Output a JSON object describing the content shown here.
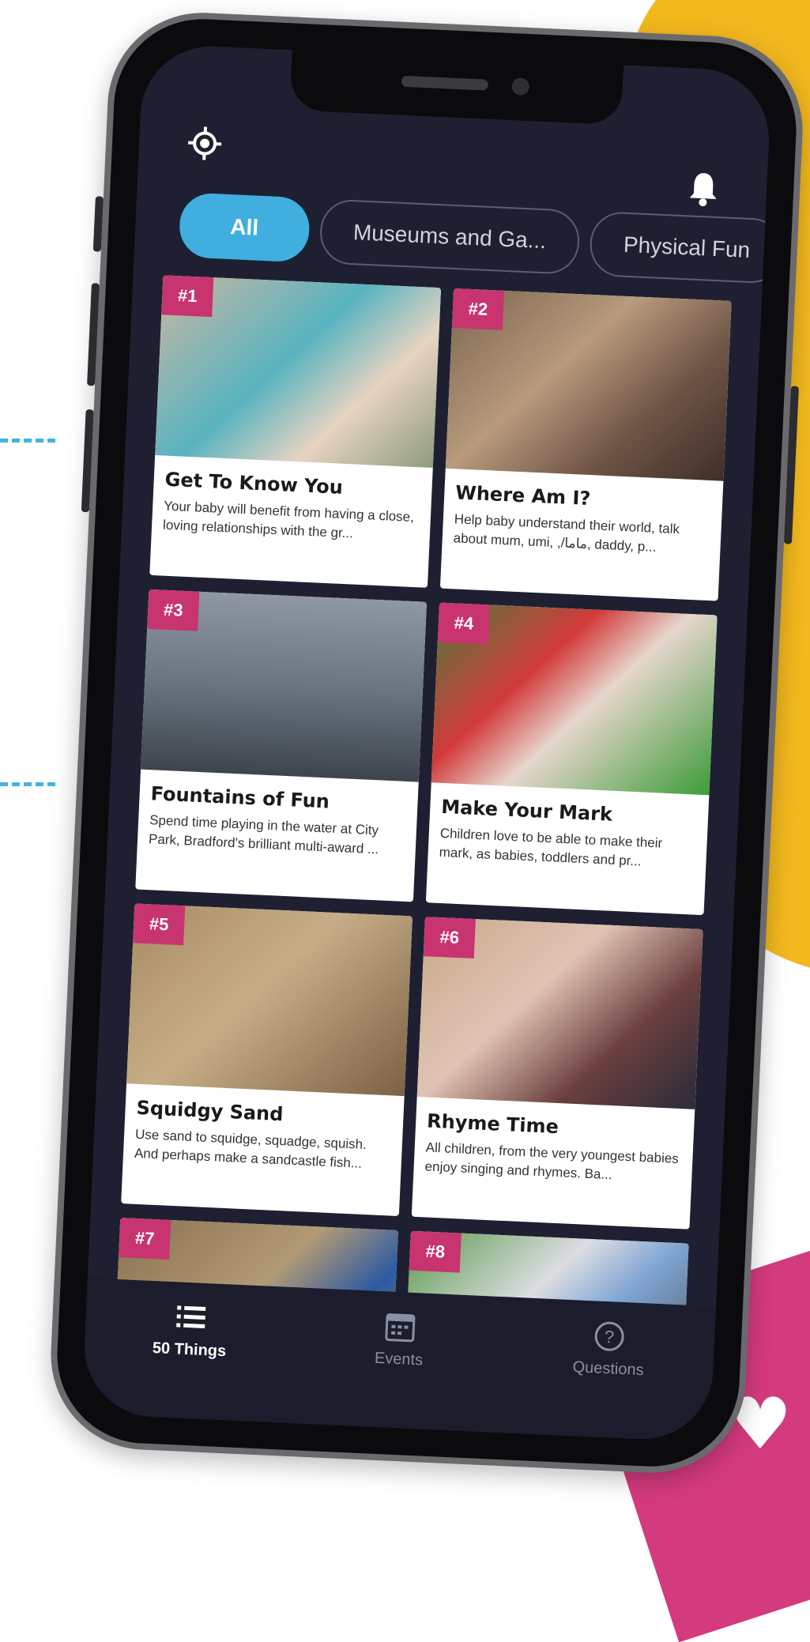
{
  "header": {
    "location_icon": "crosshair-location-icon",
    "notification_icon": "bell-icon"
  },
  "filters": {
    "chips": [
      {
        "label": "All",
        "active": true
      },
      {
        "label": "Museums and Ga...",
        "active": false
      },
      {
        "label": "Physical Fun",
        "active": false
      }
    ]
  },
  "cards": [
    {
      "badge": "#1",
      "title": "Get To Know You",
      "description": "Your baby will benefit from having a close, loving relationships with the gr..."
    },
    {
      "badge": "#2",
      "title": "Where Am I?",
      "description": "Help baby understand their world, talk about mum, umi, ,/ماما, daddy, p..."
    },
    {
      "badge": "#3",
      "title": "Fountains of Fun",
      "description": "Spend time playing in the water at City Park, Bradford's brilliant multi-award ..."
    },
    {
      "badge": "#4",
      "title": "Make Your Mark",
      "description": "Children love to be able to make their mark, as babies, toddlers and pr..."
    },
    {
      "badge": "#5",
      "title": "Squidgy Sand",
      "description": "Use sand to squidge, squadge, squish. And perhaps make a sandcastle fish..."
    },
    {
      "badge": "#6",
      "title": "Rhyme Time",
      "description": "All children, from the very youngest babies enjoy singing and rhymes. Ba..."
    },
    {
      "badge": "#7"
    },
    {
      "badge": "#8"
    }
  ],
  "bottom_nav": {
    "items": [
      {
        "label": "50 Things",
        "icon": "list-icon",
        "active": true
      },
      {
        "label": "Events",
        "icon": "calendar-icon",
        "active": false
      },
      {
        "label": "Questions",
        "icon": "question-circle-icon",
        "active": false
      }
    ]
  },
  "colors": {
    "accent_blue": "#41aee0",
    "badge_pink": "#c7346f",
    "screen_bg": "#1e2031",
    "background_yellow": "#f2b81e",
    "background_pink": "#d43a7e"
  }
}
